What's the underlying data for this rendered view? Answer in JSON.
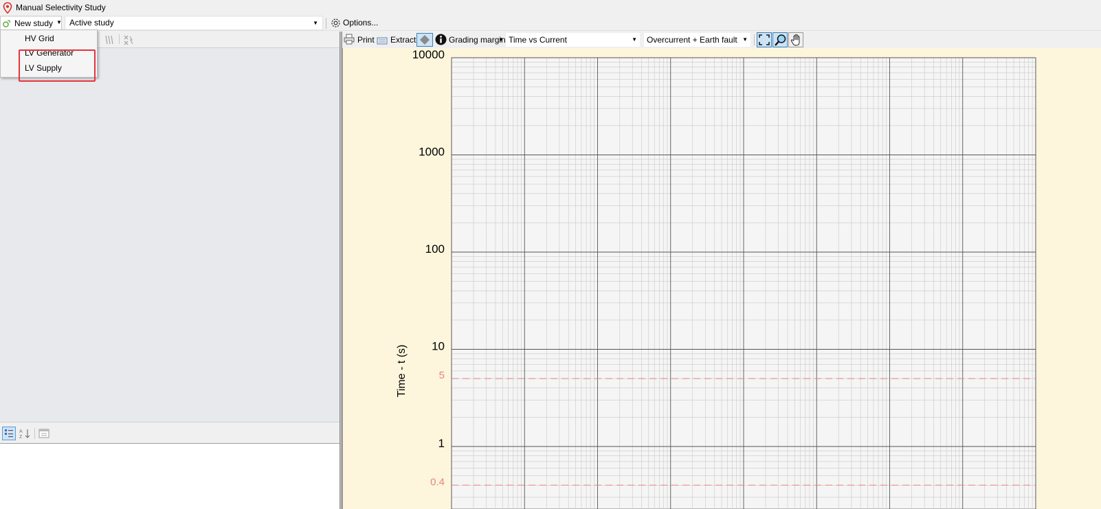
{
  "window": {
    "title": "Manual Selectivity Study"
  },
  "toolbar": {
    "new_study_label": "New study",
    "active_study_label": "Active study",
    "options_label": "Options..."
  },
  "new_study_menu": {
    "items": [
      {
        "label": "HV Grid"
      },
      {
        "label": "LV Generator"
      },
      {
        "label": "LV Supply"
      }
    ]
  },
  "chart_toolbar": {
    "print_label": "Print",
    "extract_label": "Extract",
    "grading_margin_label": "Grading margin",
    "view_mode_value": "Time vs Current",
    "fault_type_value": "Overcurrent + Earth fault"
  },
  "chart_data": {
    "type": "line",
    "ylabel": "Time - t (s)",
    "yscale": "log",
    "ytick_labels": [
      "10000",
      "1000",
      "100",
      "10",
      "1"
    ],
    "grid": true,
    "series": [],
    "reference_lines": [
      {
        "label": "5",
        "y": 5,
        "style": "dashed",
        "color": "#e8847a"
      },
      {
        "label": "0.4",
        "y": 0.4,
        "style": "dashed",
        "color": "#e8847a"
      }
    ],
    "colors": {
      "background": "#fdf6dc",
      "plot_bg": "#f5f5f5",
      "grid_major": "#555555",
      "grid_minor": "#c8c8c8"
    }
  }
}
